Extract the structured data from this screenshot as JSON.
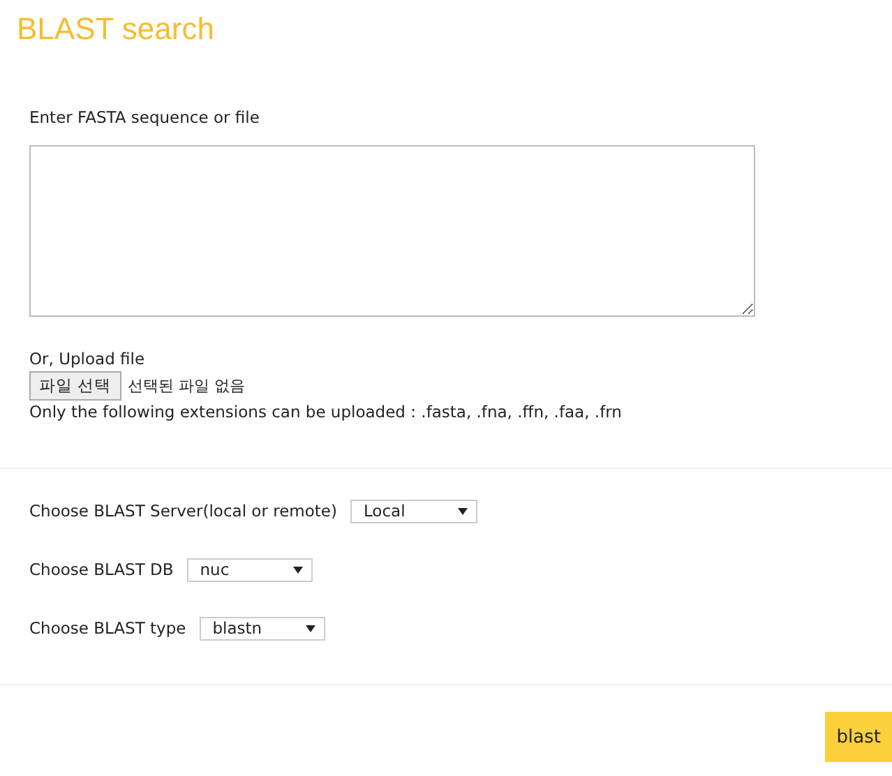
{
  "title": "BLAST search",
  "sequence": {
    "label": "Enter FASTA sequence or file"
  },
  "upload": {
    "label": "Or, Upload file",
    "button": "파일 선택",
    "status": "선택된 파일 없음",
    "note": "Only the following extensions can be uploaded : .fasta, .fna, .ffn, .faa, .frn"
  },
  "options": [
    {
      "label": "Choose BLAST Server(local or remote)",
      "value": "Local"
    },
    {
      "label": "Choose BLAST DB",
      "value": "nuc"
    },
    {
      "label": "Choose BLAST type",
      "value": "blastn"
    }
  ],
  "submit": "blast"
}
